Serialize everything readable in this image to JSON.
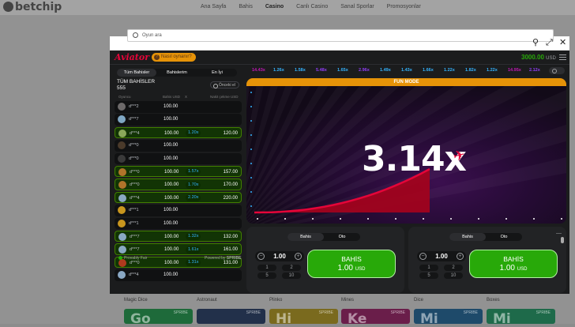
{
  "site": {
    "logo": "betchip",
    "nav": [
      {
        "label": "Ana Sayfa"
      },
      {
        "label": "Bahis"
      },
      {
        "label": "Casino"
      },
      {
        "label": "Canlı Casino"
      },
      {
        "label": "Sanal Sporlar"
      },
      {
        "label": "Promosyonlar"
      }
    ],
    "nav_active": "Casino",
    "games": [
      {
        "label": "Magic Dice",
        "thumb": "Go",
        "color": "#1e6a3a"
      },
      {
        "label": "Astronaut",
        "thumb": "",
        "color": "#22304a"
      },
      {
        "label": "Plinko",
        "thumb": "Hi",
        "color": "#7a6a1e"
      },
      {
        "label": "Mines",
        "thumb": "Ke",
        "color": "#6a1e4a"
      },
      {
        "label": "Dice",
        "thumb": "Mi",
        "color": "#1e4a6a"
      },
      {
        "label": "Boxes",
        "thumb": "Mi",
        "color": "#1e6a4a"
      }
    ],
    "thumb_tag": "SPRIBE"
  },
  "modal": {
    "search_placeholder": "Oyun ara",
    "icons": [
      "search-icon",
      "expand-icon",
      "fullscreen-icon",
      "close-icon"
    ]
  },
  "aviator": {
    "logo": "Aviator",
    "how_to": "Nasıl oynanır?",
    "balance": "3000.00",
    "currency": "USD",
    "tabs": [
      "Tüm Bahisler",
      "Bahislerim",
      "En İyi"
    ],
    "active_tab": "Tüm Bahisler",
    "bets_title": "TÜM BAHİSLER",
    "bets_count": "555",
    "previous": "Önceki el",
    "columns": {
      "player": "Oyuncu",
      "bet": "Bahis USD",
      "x": "X",
      "cashout": "Nakit çekme USD"
    },
    "rows": [
      {
        "name": "d***2",
        "bet": "100.00",
        "mult": "",
        "cashout": "",
        "win": false,
        "avatar": "#6d6a6a"
      },
      {
        "name": "d***7",
        "bet": "100.00",
        "mult": "",
        "cashout": "",
        "win": false,
        "avatar": "#7fa7c3"
      },
      {
        "name": "d***4",
        "bet": "100.00",
        "mult": "1.20x",
        "cashout": "120.00",
        "win": true,
        "avatar": "#8aa85a"
      },
      {
        "name": "d***0",
        "bet": "100.00",
        "mult": "",
        "cashout": "",
        "win": false,
        "avatar": "#4a3a2a"
      },
      {
        "name": "d***0",
        "bet": "100.00",
        "mult": "",
        "cashout": "",
        "win": false,
        "avatar": "#3a3a3a"
      },
      {
        "name": "d***0",
        "bet": "100.00",
        "mult": "1.57x",
        "cashout": "157.00",
        "win": true,
        "avatar": "#b0742a"
      },
      {
        "name": "d***0",
        "bet": "100.00",
        "mult": "1.70x",
        "cashout": "170.00",
        "win": true,
        "avatar": "#b0742a"
      },
      {
        "name": "d***4",
        "bet": "100.00",
        "mult": "2.20x",
        "cashout": "220.00",
        "win": true,
        "avatar": "#8aa8c3"
      },
      {
        "name": "d***1",
        "bet": "100.00",
        "mult": "",
        "cashout": "",
        "win": false,
        "avatar": "#c8961e"
      },
      {
        "name": "d***1",
        "bet": "100.00",
        "mult": "",
        "cashout": "",
        "win": false,
        "avatar": "#c8961e"
      },
      {
        "name": "d***7",
        "bet": "100.00",
        "mult": "1.32x",
        "cashout": "132.00",
        "win": true,
        "avatar": "#8aa8c3"
      },
      {
        "name": "d***7",
        "bet": "100.00",
        "mult": "1.61x",
        "cashout": "161.00",
        "win": true,
        "avatar": "#8aa8c3"
      },
      {
        "name": "d***0",
        "bet": "100.00",
        "mult": "1.31x",
        "cashout": "131.00",
        "win": true,
        "avatar": "#b03a1e"
      },
      {
        "name": "d***4",
        "bet": "100.00",
        "mult": "",
        "cashout": "",
        "win": false,
        "avatar": "#8aa8c3"
      }
    ],
    "provably": "Provably Fair",
    "powered": "Powered by",
    "spribe": "SPRIBE",
    "history": [
      {
        "v": "14.43x",
        "c": "#c017b4"
      },
      {
        "v": "1.26x",
        "c": "#34b4ff"
      },
      {
        "v": "1.58x",
        "c": "#34b4ff"
      },
      {
        "v": "5.48x",
        "c": "#913ef8"
      },
      {
        "v": "1.65x",
        "c": "#34b4ff"
      },
      {
        "v": "2.96x",
        "c": "#913ef8"
      },
      {
        "v": "1.49x",
        "c": "#34b4ff"
      },
      {
        "v": "1.43x",
        "c": "#34b4ff"
      },
      {
        "v": "1.66x",
        "c": "#34b4ff"
      },
      {
        "v": "1.22x",
        "c": "#34b4ff"
      },
      {
        "v": "1.82x",
        "c": "#34b4ff"
      },
      {
        "v": "1.22x",
        "c": "#34b4ff"
      },
      {
        "v": "14.95x",
        "c": "#c017b4"
      },
      {
        "v": "2.12x",
        "c": "#913ef8"
      }
    ],
    "fun_mode": "FUN MODE",
    "multiplier": "3.14x",
    "panels": [
      {
        "tab_bet": "Bahis",
        "tab_auto": "Oto",
        "stake": "1.00",
        "quick": [
          "1",
          "2",
          "5",
          "10"
        ],
        "btn_label": "BAHİS",
        "btn_amount": "1.00",
        "btn_currency": "USD"
      },
      {
        "tab_bet": "Bahis",
        "tab_auto": "Oto",
        "stake": "1.00",
        "quick": [
          "1",
          "2",
          "5",
          "10"
        ],
        "btn_label": "BAHİS",
        "btn_amount": "1.00",
        "btn_currency": "USD"
      }
    ],
    "colors": {
      "green": "#28a909",
      "red": "#e50539",
      "orange": "#e69308",
      "blue": "#34b4ff",
      "purple": "#913ef8",
      "pink": "#c017b4"
    }
  }
}
